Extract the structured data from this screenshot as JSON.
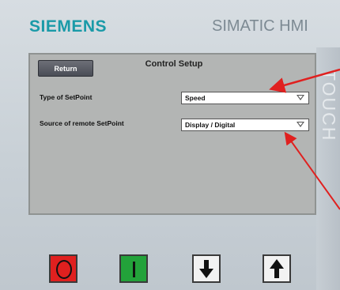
{
  "device": {
    "brand": "SIEMENS",
    "product": "SIMATIC HMI",
    "side_label": "TOUCH"
  },
  "screen": {
    "title": "Control Setup",
    "return_label": "Return",
    "rows": [
      {
        "label": "Type of SetPoint",
        "value": "Speed"
      },
      {
        "label": "Source of remote SetPoint",
        "value": "Display / Digital"
      }
    ]
  },
  "keys": [
    {
      "name": "stop-key",
      "icon": "circle-o",
      "color": "#e0201f"
    },
    {
      "name": "start-key",
      "icon": "bar-i",
      "color": "#23a23a"
    },
    {
      "name": "down-key",
      "icon": "arrow-down"
    },
    {
      "name": "up-key",
      "icon": "arrow-up"
    }
  ],
  "annotation_color": "#e0201f"
}
